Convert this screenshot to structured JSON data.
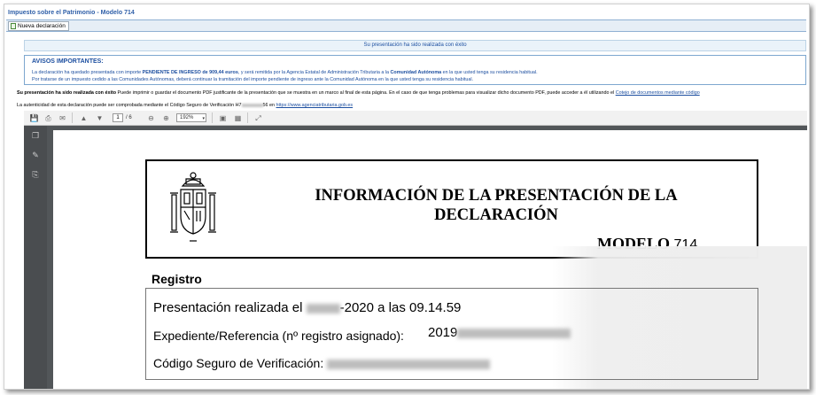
{
  "app_title": "Impuesto sobre el Patrimonio - Modelo 714",
  "tab": {
    "label": "Nueva declaración",
    "icon": "document-icon"
  },
  "success_message": "Su presentación ha sido realizada con éxito",
  "notices": {
    "heading": "AVISOS IMPORTANTES:",
    "line1_a": "La declaración ha quedado presentada con importe ",
    "line1_b": "PENDIENTE DE INGRESO de 909,44 euros",
    "line1_c": ", y será remitida por la Agencia Estatal de Administración Tributaria a la ",
    "line1_d": "Comunidad Autónoma",
    "line1_e": " en la que usted tenga su residencia habitual.",
    "line2": "Por tratarse de un impuesto cedido a las Comunidades Autónomas, deberá continuar la tramitación del importe pendiente de ingreso ante la Comunidad Autónoma en la que usted tenga su residencia habitual."
  },
  "info": {
    "line1_a": "Su presentación ha sido realizada con éxito",
    "line1_b": " Puede imprimir o guardar el documento PDF justificante de la presentación que se muestra en un marco al final de esta página. En el caso de que tenga problemas para visualizar dicho documento PDF, puede acceder a él utilizando el ",
    "line1_link": "Cotejo de documentos mediante código",
    "line2_a": "La autenticidad de esta declaración puede ser comprobada mediante el Código Seguro de Verificación H7",
    "line2_b": "56 en ",
    "line2_link": "https://www.agenciatributaria.gob.es"
  },
  "viewer": {
    "page_current": "1",
    "page_total": "/ 6",
    "zoom": "192%",
    "page": {
      "title": "INFORMACIÓN DE LA PRESENTACIÓN DE LA DECLARACIÓN",
      "modelo_label": "MODELO",
      "modelo_number": "714",
      "registro_heading": "Registro",
      "presentacion_label": "Presentación realizada el",
      "presentacion_date_tail": "-2020",
      "presentacion_time": "a las 09.14.59",
      "expediente_label": "Expediente/Referencia (nº registro asignado):",
      "expediente_prefix": "2019",
      "csv_label": "Código Seguro de Verificación:"
    }
  },
  "colors": {
    "link": "#1d4fa0",
    "viewer_bg": "#525659",
    "toolbar_bg": "#f1f1f1"
  }
}
